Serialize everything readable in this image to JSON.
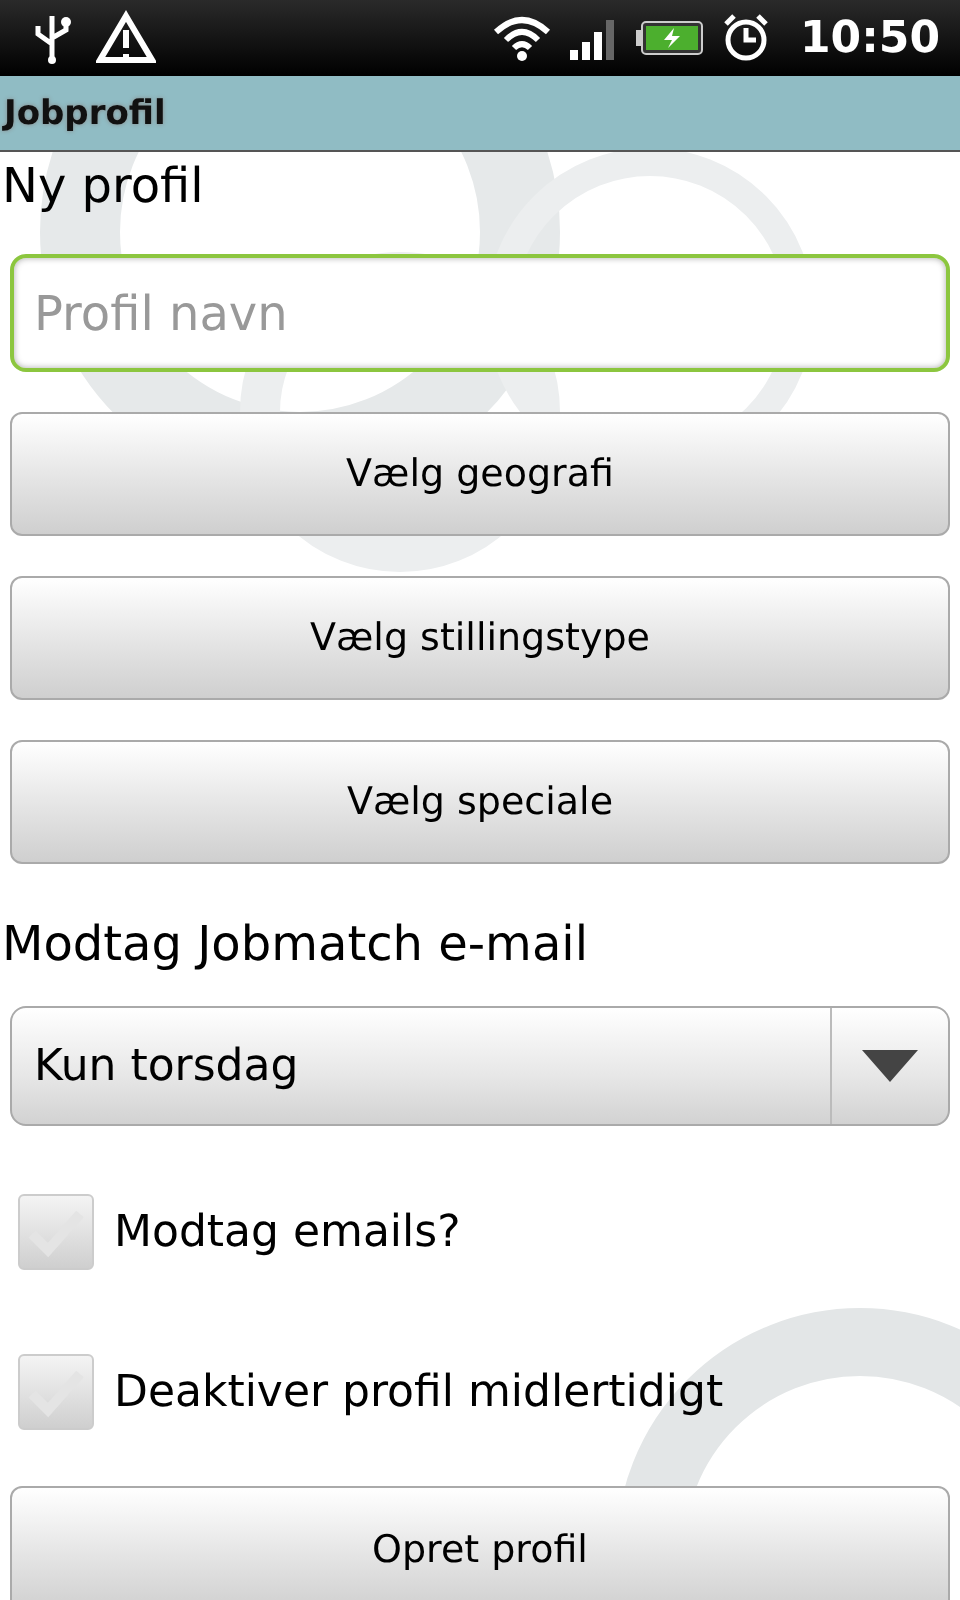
{
  "status_bar": {
    "time": "10:50"
  },
  "title_bar": {
    "title": "Jobprofil"
  },
  "heading": "Ny profil",
  "profile_name": {
    "placeholder": "Profil navn"
  },
  "buttons": [
    "Vælg geografi",
    "Vælg stillingstype",
    "Vælg speciale"
  ],
  "email_label": "Modtag Jobmatch e-mail",
  "frequency": {
    "value": "Kun torsdag"
  },
  "options": [
    {
      "label": "Modtag emails?",
      "checked": false
    },
    {
      "label": "Deaktiver profil midlertidigt",
      "checked": false
    }
  ],
  "submit": "Opret profil"
}
